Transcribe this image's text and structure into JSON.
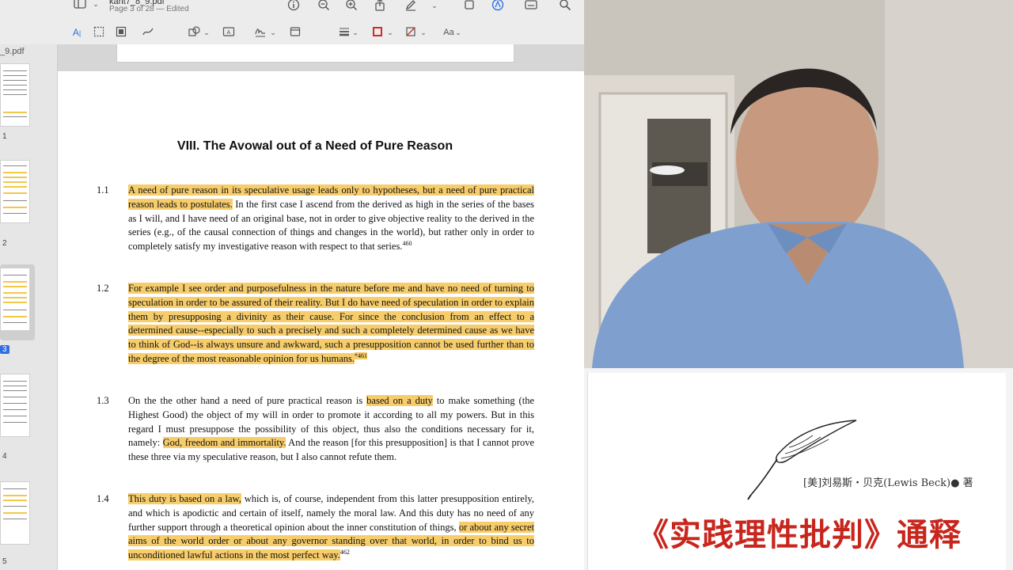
{
  "toolbar": {
    "file_name": "kant7_8_9.pdf",
    "page_status": "Page 3 of 28 — Edited",
    "markup_label": "Aa"
  },
  "sidebar": {
    "file_label": "_9.pdf",
    "thumbnails": [
      {
        "number": "1"
      },
      {
        "number": "2"
      },
      {
        "number": "3",
        "active": true
      },
      {
        "number": "4"
      },
      {
        "number": "5"
      }
    ]
  },
  "document": {
    "heading": "VIII. The Avowal out of a Need of Pure Reason",
    "paragraphs": [
      {
        "number": "1.1",
        "hl1": "A need of pure reason in its speculative usage leads only to hypotheses, but a need of pure practical reason leads to postulates.",
        "text1": " In the first case I ascend from the derived as high in the series of the bases as I will, and I have need of an original base, not in order to give objective reality to the derived in the series (e.g., of the causal connection of things and changes in the world), but rather only in order to completely satisfy my investigative reason with respect to that series.",
        "note": "460"
      },
      {
        "number": "1.2",
        "hl1": "For example I see order and purposefulness in the nature before me and have no need of turning to speculation in order to be assured of their reality. But I do have need of speculation in order to explain them by presupposing a divinity as their cause. For since the conclusion from an effect to a determined cause--especially to such a precisely and such a completely determined cause as we have to think of God--is always unsure and awkward, such a presupposition cannot be used further than to the degree of the most reasonable opinion for us humans.",
        "note": "*461"
      },
      {
        "number": "1.3",
        "text1": "On the the other hand a need of pure practical reason is ",
        "hl1": "based on a duty",
        "text2": " to make something (the Highest Good) the object of my will in order to promote it according to all my powers. But in this regard I must presuppose the possibility of this object, thus also the conditions necessary for it, namely: ",
        "hl2": "God, freedom and immortality.",
        "text3": " And the reason [for this presupposition] is that I cannot prove these three via my speculative reason, but I also cannot refute them."
      },
      {
        "number": "1.4",
        "hl1": "This duty is based on a law,",
        "text1": " which is, of course, independent from this latter presupposition entirely, and which is apodictic and certain of itself, namely the moral law. And this duty has no need of any further support through a theoretical opinion about the inner constitution of things, ",
        "hl2": "or about any secret aims of the world order or about any governor standing over that world, in order to bind us to unconditioned lawful actions in the most perfect way.",
        "note": "462"
      }
    ]
  },
  "book": {
    "author": "[美]刘易斯・贝克(Lewis Beck)● 著",
    "title": "《实践理性批判》通释"
  },
  "colors": {
    "highlight": "#f7cd6b",
    "title_red": "#c8261d",
    "active_page": "#2f6fe0"
  }
}
